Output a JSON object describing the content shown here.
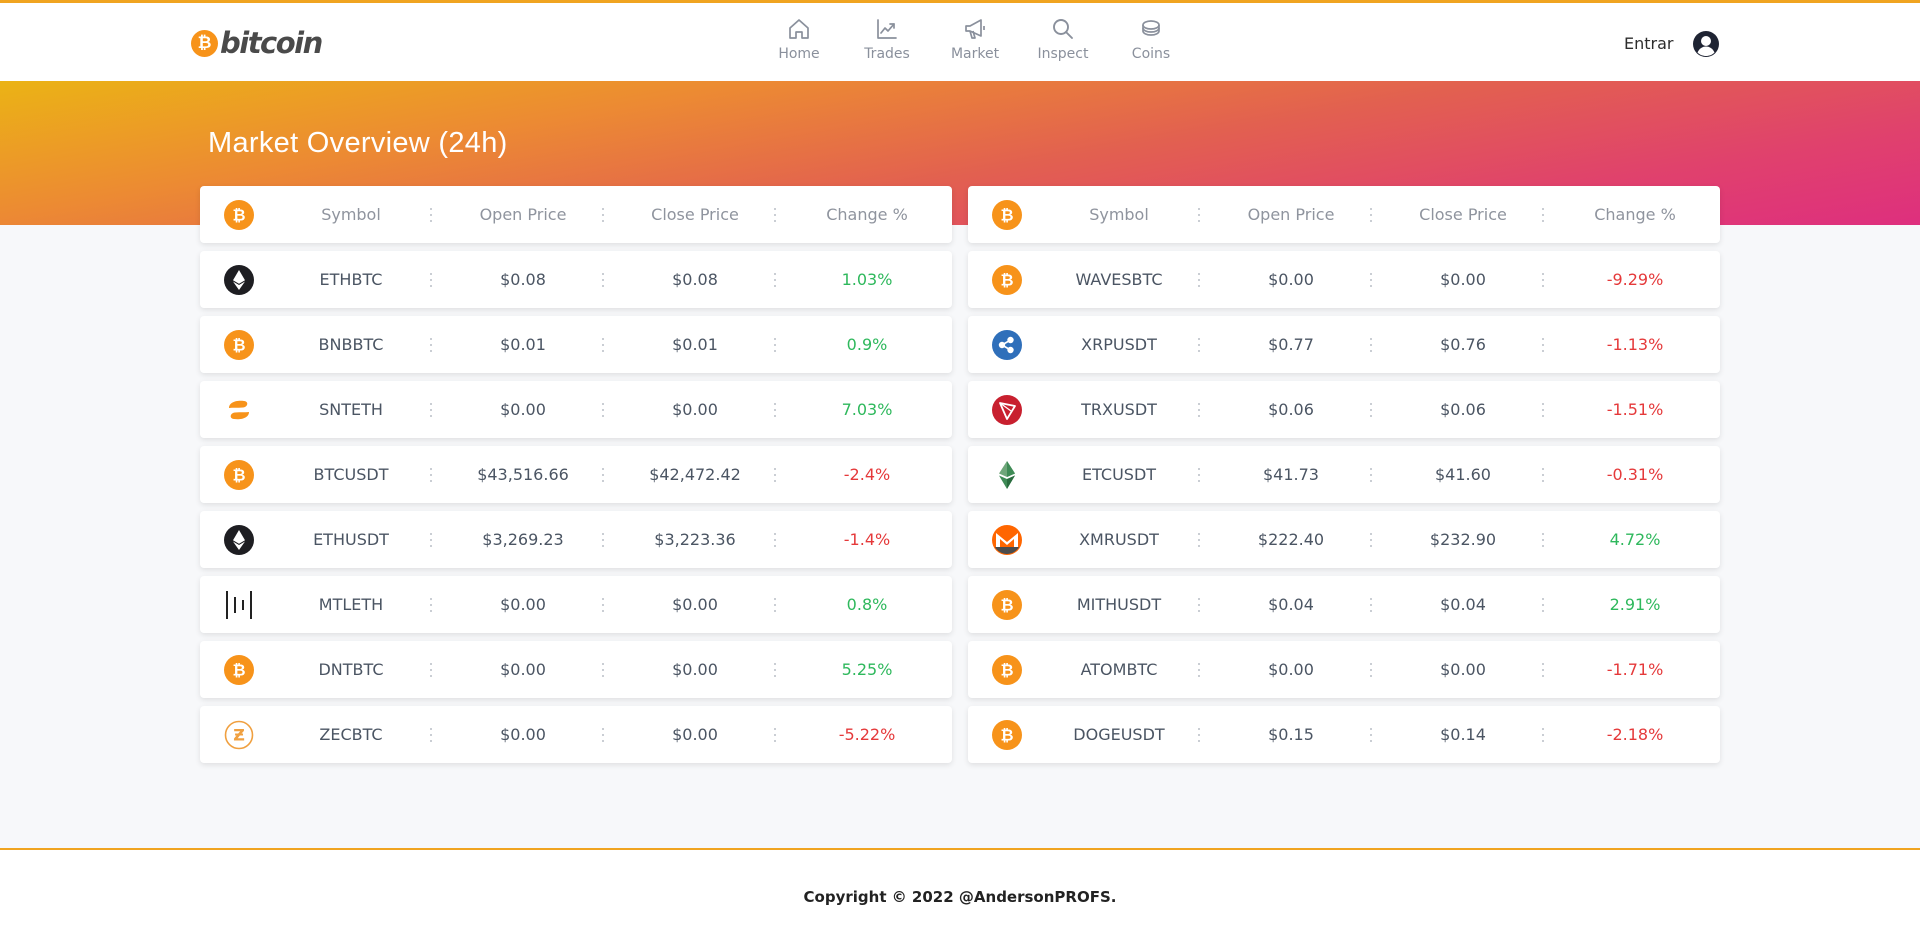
{
  "header": {
    "logo_text": "bitcoin",
    "nav": [
      {
        "label": "Home",
        "icon": "home-icon"
      },
      {
        "label": "Trades",
        "icon": "chart-line-icon"
      },
      {
        "label": "Market",
        "icon": "megaphone-icon"
      },
      {
        "label": "Inspect",
        "icon": "search-icon"
      },
      {
        "label": "Coins",
        "icon": "coins-icon"
      }
    ],
    "login_label": "Entrar",
    "avatar_icon": "user-circle-icon"
  },
  "page": {
    "title": "Market Overview (24h)"
  },
  "columns": [
    "Symbol",
    "Open Price",
    "Close Price",
    "Change %"
  ],
  "colors": {
    "accent": "#f0a420",
    "positive": "#2eb85c",
    "negative": "#e5393a",
    "bitcoin": "#f7931a"
  },
  "left_table": [
    {
      "icon": "ethereum",
      "symbol": "ETHBTC",
      "open": "$0.08",
      "close": "$0.08",
      "change": "1.03%",
      "dir": "pos"
    },
    {
      "icon": "bitcoin",
      "symbol": "BNBBTC",
      "open": "$0.01",
      "close": "$0.01",
      "change": "0.9%",
      "dir": "pos"
    },
    {
      "icon": "status",
      "symbol": "SNTETH",
      "open": "$0.00",
      "close": "$0.00",
      "change": "7.03%",
      "dir": "pos"
    },
    {
      "icon": "bitcoin",
      "symbol": "BTCUSDT",
      "open": "$43,516.66",
      "close": "$42,472.42",
      "change": "-2.4%",
      "dir": "neg"
    },
    {
      "icon": "ethereum",
      "symbol": "ETHUSDT",
      "open": "$3,269.23",
      "close": "$3,223.36",
      "change": "-1.4%",
      "dir": "neg"
    },
    {
      "icon": "metal",
      "symbol": "MTLETH",
      "open": "$0.00",
      "close": "$0.00",
      "change": "0.8%",
      "dir": "pos"
    },
    {
      "icon": "bitcoin",
      "symbol": "DNTBTC",
      "open": "$0.00",
      "close": "$0.00",
      "change": "5.25%",
      "dir": "pos"
    },
    {
      "icon": "zcash",
      "symbol": "ZECBTC",
      "open": "$0.00",
      "close": "$0.00",
      "change": "-5.22%",
      "dir": "neg"
    }
  ],
  "right_table": [
    {
      "icon": "bitcoin",
      "symbol": "WAVESBTC",
      "open": "$0.00",
      "close": "$0.00",
      "change": "-9.29%",
      "dir": "neg"
    },
    {
      "icon": "ripple",
      "symbol": "XRPUSDT",
      "open": "$0.77",
      "close": "$0.76",
      "change": "-1.13%",
      "dir": "neg"
    },
    {
      "icon": "tron",
      "symbol": "TRXUSDT",
      "open": "$0.06",
      "close": "$0.06",
      "change": "-1.51%",
      "dir": "neg"
    },
    {
      "icon": "ethereum-classic",
      "symbol": "ETCUSDT",
      "open": "$41.73",
      "close": "$41.60",
      "change": "-0.31%",
      "dir": "neg"
    },
    {
      "icon": "monero",
      "symbol": "XMRUSDT",
      "open": "$222.40",
      "close": "$232.90",
      "change": "4.72%",
      "dir": "pos"
    },
    {
      "icon": "bitcoin",
      "symbol": "MITHUSDT",
      "open": "$0.04",
      "close": "$0.04",
      "change": "2.91%",
      "dir": "pos"
    },
    {
      "icon": "bitcoin",
      "symbol": "ATOMBTC",
      "open": "$0.00",
      "close": "$0.00",
      "change": "-1.71%",
      "dir": "neg"
    },
    {
      "icon": "bitcoin",
      "symbol": "DOGEUSDT",
      "open": "$0.15",
      "close": "$0.14",
      "change": "-2.18%",
      "dir": "neg"
    }
  ],
  "footer": {
    "copyright": "Copyright © 2022 @AndersonPROFS."
  }
}
